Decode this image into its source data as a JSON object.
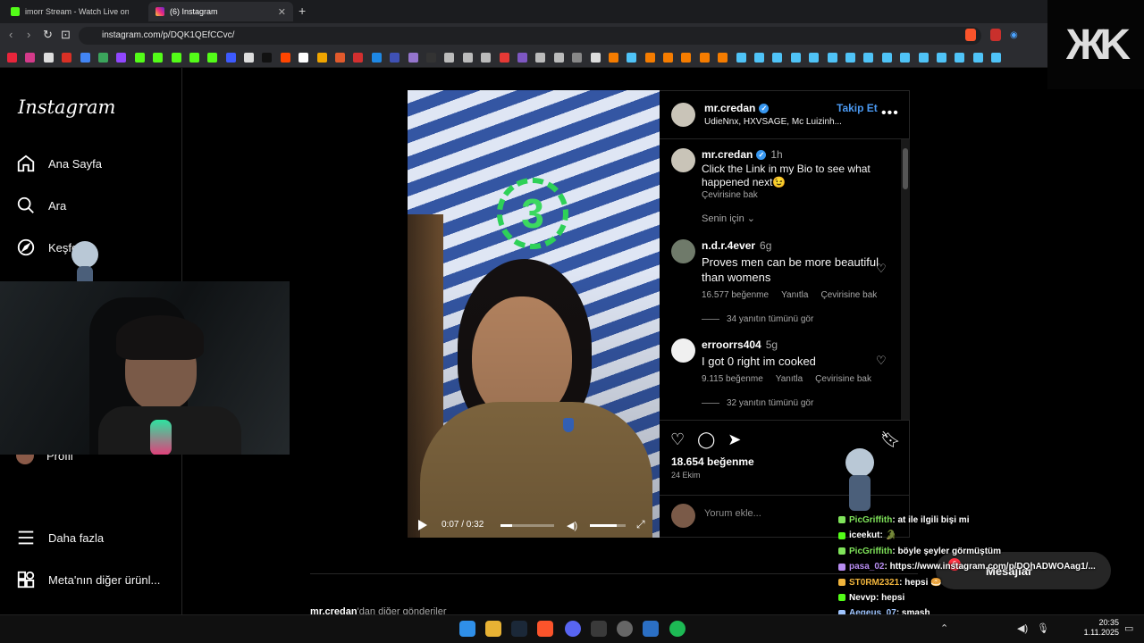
{
  "browser": {
    "tabs": [
      {
        "title": "imorr Stream - Watch Live on Kic",
        "active": false
      },
      {
        "title": "(6) Instagram",
        "active": true
      }
    ],
    "url": "instagram.com/p/DQK1QEfCCvc/"
  },
  "sidebar": {
    "logo": "Instagram",
    "items": [
      {
        "label": "Ana Sayfa",
        "icon": "home-icon"
      },
      {
        "label": "Ara",
        "icon": "search-icon"
      },
      {
        "label": "Keşfet",
        "icon": "compass-icon"
      },
      {
        "label": "Profil",
        "icon": "avatar"
      },
      {
        "label": "Daha fazla",
        "icon": "menu-icon"
      },
      {
        "label": "Meta'nın diğer ürünl...",
        "icon": "apps-icon"
      }
    ]
  },
  "post": {
    "header": {
      "username": "mr.credan",
      "follow_label": "Takip Et",
      "subtitle": "UdieNnx, HXVSAGE, Mc Luizinh..."
    },
    "caption": {
      "username": "mr.credan",
      "time": "1h",
      "text": "Click the Link in my Bio to see what happened next😉",
      "translate": "Çevirisine bak"
    },
    "for_you": "Senin için ⌄",
    "comments": [
      {
        "username": "n.d.r.4ever",
        "time": "6g",
        "text": "Proves men can be more beautiful than womens",
        "likes": "16.577 beğenme",
        "reply": "Yanıtla",
        "translate": "Çevirisine bak",
        "replies": "34 yanıtın tümünü gör"
      },
      {
        "username": "erroorrs404",
        "time": "5g",
        "text": "I got 0 right im cooked",
        "likes": "9.115 beğenme",
        "reply": "Yanıtla",
        "translate": "Çevirisine bak",
        "replies": "32 yanıtın tümünü gör"
      }
    ],
    "likes": "18.654 beğenme",
    "date": "24 Ekim",
    "comment_placeholder": "Yorum ekle...",
    "video": {
      "countdown": "3",
      "time": "0:07 / 0:32",
      "progress": 0.22,
      "volume": 0.75
    }
  },
  "more_posts": {
    "user": "mr.credan",
    "suffix": "'dan diğer gönderiler"
  },
  "messages": {
    "label": "Mesajlar",
    "badge": "6"
  },
  "chat": [
    {
      "user": "PicGriffith",
      "color": "#7fe35a",
      "text": ": at ile ilgili bişi mi"
    },
    {
      "user": "iceekut",
      "color": "#ffffff",
      "text": ": 🐊"
    },
    {
      "user": "PicGriffith",
      "color": "#7fe35a",
      "text": ": böyle şeyler görmüştüm"
    },
    {
      "user": "pasa_02",
      "color": "#b78cf0",
      "text": ": https://www.instagram.com/p/DQhADWOAag1/..."
    },
    {
      "user": "ST0RM2321",
      "color": "#f0b43c",
      "text": ": hepsi 🥯"
    },
    {
      "user": "Nevvp",
      "color": "#ffffff",
      "text": ": hepsi"
    },
    {
      "user": "Aegeus_07",
      "color": "#9fc5ff",
      "text": ": smash"
    }
  ],
  "clock": {
    "time": "20:35",
    "date": "1.11.2025"
  },
  "colors": {
    "accent": "#4a98f0",
    "background": "#000000",
    "verified": "#3797f0",
    "countdown": "#3cd860"
  }
}
